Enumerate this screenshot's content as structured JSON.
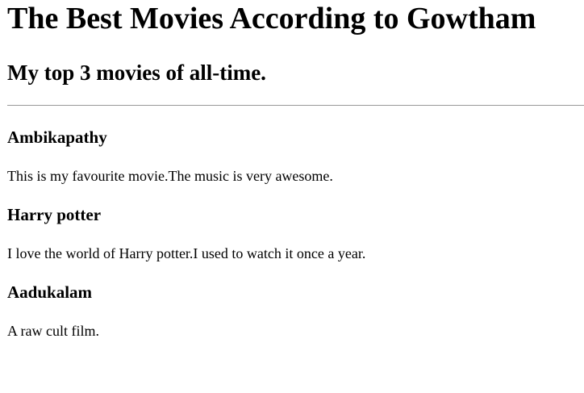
{
  "page": {
    "title": "The Best Movies According to Gowtham",
    "subtitle": "My top 3 movies of all-time."
  },
  "movies": [
    {
      "name": "Ambikapathy",
      "description": "This is my favourite movie.The music is very awesome."
    },
    {
      "name": "Harry potter",
      "description": "I love the world of Harry potter.I used to watch it once a year."
    },
    {
      "name": "Aadukalam",
      "description": "A raw cult film."
    }
  ]
}
